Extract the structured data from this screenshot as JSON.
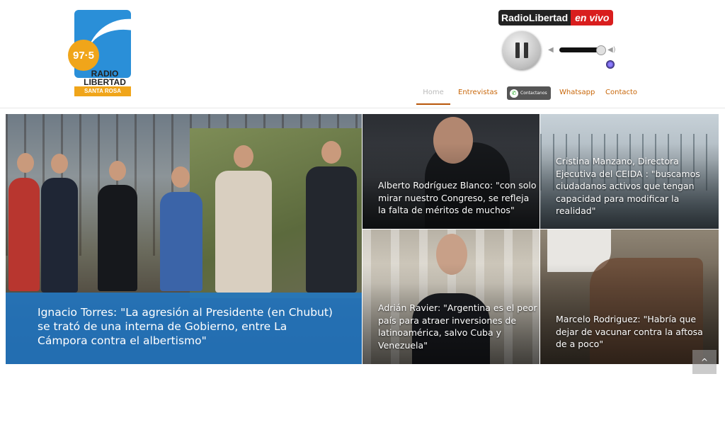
{
  "logo": {
    "frequency": "97·5",
    "name": "RADIO LIBERTAD",
    "city": "SANTA ROSA"
  },
  "player": {
    "brand": "RadioLibertad",
    "live": "en vivo",
    "state": "playing",
    "volume": 0.9
  },
  "nav": {
    "items": [
      {
        "label": "Home",
        "active": true
      },
      {
        "label": "Entrevistas"
      },
      {
        "label": "Whatsapp"
      },
      {
        "label": "Contacto"
      }
    ],
    "whatsapp_button": "Contactanos"
  },
  "articles": [
    {
      "title": "Ignacio Torres: \"La agresión al Presidente (en Chubut) se trató de una interna de Gobierno, entre La Cámpora contra el albertismo\""
    },
    {
      "title": "Alberto Rodríguez Blanco: \"con solo mirar nuestro Congreso, se refleja la falta de méritos de muchos\""
    },
    {
      "title": "Cristina Manzano, Directora Ejecutiva del CEIDA : \"buscamos ciudadanos activos que tengan capacidad para modificar la realidad\""
    },
    {
      "title": "Adrián Ravier: \"Argentina es el peor país para atraer inversiones de latinoamérica, salvo Cuba y Venezuela\""
    },
    {
      "title": "Marcelo Rodriguez: \"Habría que dejar de vacunar contra la aftosa de a poco\""
    }
  ],
  "icons": {
    "whatsapp": "whatsapp-icon",
    "scroll_top": "chevron-up-icon"
  },
  "colors": {
    "accent": "#c8670a",
    "brand_blue": "#2a8fd8",
    "brand_orange": "#f0a51a",
    "live_red": "#d91e1e"
  }
}
